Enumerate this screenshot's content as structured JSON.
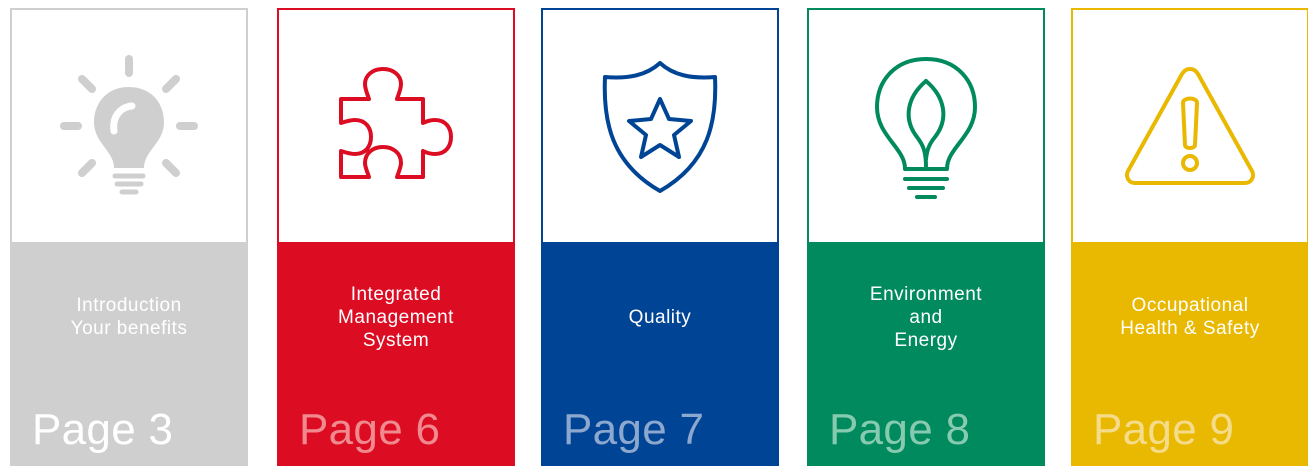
{
  "cards": [
    {
      "title": "Introduction\nYour benefits",
      "page": "Page 3",
      "icon": "lightbulb-idea-icon",
      "color": "#cfcfcf"
    },
    {
      "title": "Integrated\nManagement\nSystem",
      "page": "Page 6",
      "icon": "puzzle-piece-icon",
      "color": "#dc0c23"
    },
    {
      "title": "Quality",
      "page": "Page 7",
      "icon": "shield-star-icon",
      "color": "#004595"
    },
    {
      "title": "Environment\nand\nEnergy",
      "page": "Page 8",
      "icon": "leaf-bulb-icon",
      "color": "#008a5e"
    },
    {
      "title": "Occupational\nHealth & Safety",
      "page": "Page 9",
      "icon": "warning-triangle-icon",
      "color": "#e9b800"
    }
  ]
}
